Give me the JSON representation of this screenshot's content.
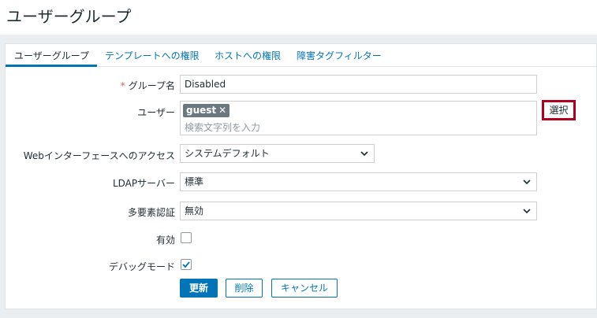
{
  "page": {
    "title": "ユーザーグループ"
  },
  "tabs": [
    {
      "label": "ユーザーグループ",
      "active": true
    },
    {
      "label": "テンプレートへの権限"
    },
    {
      "label": "ホストへの権限"
    },
    {
      "label": "障害タグフィルター"
    }
  ],
  "form": {
    "group_name": {
      "label": "グループ名",
      "required_mark": "*",
      "value": "Disabled"
    },
    "users": {
      "label": "ユーザー",
      "chips": [
        "guest"
      ],
      "chip_remove": "✕",
      "placeholder": "検索文字列を入力",
      "select_button": "選択"
    },
    "web_access": {
      "label": "Webインターフェースへのアクセス",
      "value": "システムデフォルト"
    },
    "ldap": {
      "label": "LDAPサーバー",
      "value": "標準"
    },
    "mfa": {
      "label": "多要素認証",
      "value": "無効"
    },
    "enabled": {
      "label": "有効",
      "checked": false
    },
    "debug": {
      "label": "デバッグモード",
      "checked": true
    }
  },
  "buttons": {
    "update": "更新",
    "delete": "削除",
    "cancel": "キャンセル"
  },
  "colors": {
    "accent": "#0275b8",
    "highlight_border": "#b00020",
    "chip_bg": "#6b7880"
  }
}
